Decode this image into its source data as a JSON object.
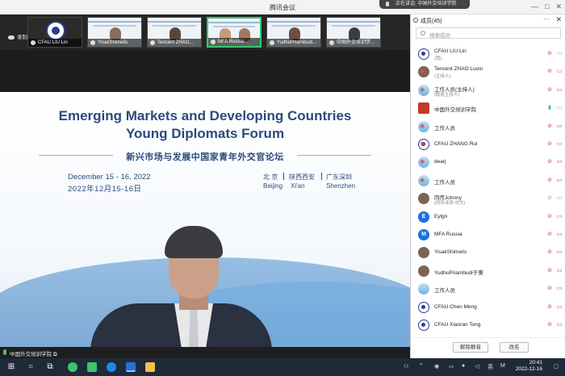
{
  "window": {
    "title": "腾讯会议",
    "speaking_label": "正在讲话: 中国外交培训学院",
    "controls": [
      "—",
      "□",
      "✕"
    ]
  },
  "strip": {
    "recording_label": "录制中",
    "thumbnails": [
      {
        "name": "CFAU LIU Lin"
      },
      {
        "name": "YisakShimelis"
      },
      {
        "name": "Tencent ZHAO..."
      },
      {
        "name": "MFA Russia"
      },
      {
        "name": "YudhoPriambudi..."
      },
      {
        "name": "中国外交培训学..."
      }
    ]
  },
  "banner": {
    "title_line1": "Emerging Markets and Developing Countries",
    "title_line2": "Young  Diplomats  Forum",
    "title_cn": "新兴市场与发展中国家青年外交官论坛",
    "date_en": "December 15 - 16, 2022",
    "date_cn": "2022年12月15-16日",
    "cities_cn": [
      "北 京",
      "陕西西安",
      "广东深圳"
    ],
    "cities_en": [
      "Beijing",
      "Xi'an",
      "Shenzhen"
    ]
  },
  "video": {
    "speaker_label": "中国外交培训学院"
  },
  "panel": {
    "title": "成员(45)",
    "more": "···",
    "close": "✕",
    "search_placeholder": "搜索成员",
    "members": [
      {
        "name": "CFAU LIU Lin",
        "sub": "(我)",
        "avatar": "seal"
      },
      {
        "name": "Tencent ZHAO Luoxi",
        "sub": "(主持人)",
        "avatar": "photo"
      },
      {
        "name": "工作人员(主持人)",
        "sub": "(联席主持人)",
        "avatar": "sky"
      },
      {
        "name": "中国外交培训学院",
        "sub": "",
        "avatar": "red"
      },
      {
        "name": "工作人员",
        "sub": "",
        "avatar": "sky"
      },
      {
        "name": "CFAU ZHANG Rui",
        "sub": "",
        "avatar": "seal"
      },
      {
        "name": "dearj",
        "sub": "",
        "avatar": "sky"
      },
      {
        "name": "工作人员",
        "sub": "",
        "avatar": "sky"
      },
      {
        "name": "同传Johnny",
        "sub": "(同传译员-中文)",
        "avatar": "photo"
      },
      {
        "name": "Eylgn",
        "sub": "",
        "avatar": "letter",
        "letter": "E"
      },
      {
        "name": "MFA Russia",
        "sub": "",
        "avatar": "letter",
        "letter": "M"
      },
      {
        "name": "YisakShimelis",
        "sub": "",
        "avatar": "photo"
      },
      {
        "name": "YudhoPriambudi于東",
        "sub": "",
        "avatar": "photo"
      },
      {
        "name": "工作人员",
        "sub": "",
        "avatar": "sky"
      },
      {
        "name": "CFAU Chen Meng",
        "sub": "",
        "avatar": "seal"
      },
      {
        "name": "CFAU Xiaoran Tong",
        "sub": "",
        "avatar": "seal"
      }
    ],
    "unmute_all_label": "解除静音",
    "rename_label": "改名"
  },
  "taskbar": {
    "ime_label": "英",
    "ime_mode": "M",
    "time": "20:41",
    "date": "2022-12-16"
  },
  "colors": {
    "accent_blue": "#2c4a7c",
    "mute_red": "#d94848",
    "active_green": "#2ecc71"
  }
}
